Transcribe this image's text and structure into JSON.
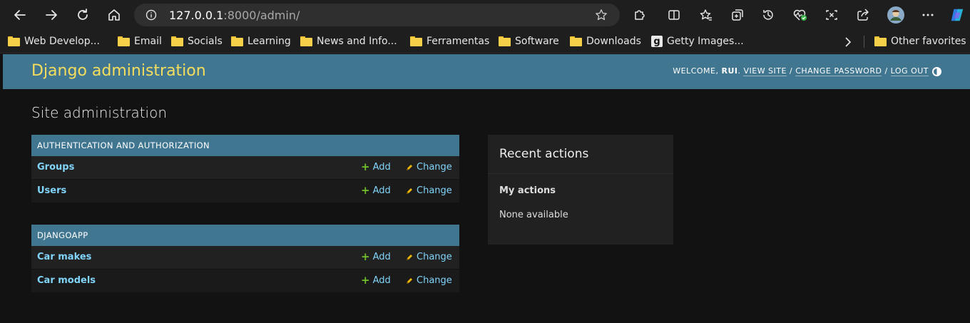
{
  "browser": {
    "url_host": "127.0.0.1",
    "url_rest": ":8000/admin/",
    "bookmarks": [
      {
        "label": "Web Develop...",
        "icon": "folder-icon"
      },
      {
        "label": "Email",
        "icon": "folder-icon"
      },
      {
        "label": "Socials",
        "icon": "folder-icon"
      },
      {
        "label": "Learning",
        "icon": "folder-icon"
      },
      {
        "label": "News and Info...",
        "icon": "folder-icon"
      },
      {
        "label": "Ferramentas",
        "icon": "folder-icon"
      },
      {
        "label": "Software",
        "icon": "folder-icon"
      },
      {
        "label": "Downloads",
        "icon": "folder-icon"
      },
      {
        "label": "Getty Images...",
        "icon": "getty-g-icon",
        "glyph": "g"
      }
    ],
    "overflow_icon": "chevron-right-icon",
    "other_favorites": "Other favorites"
  },
  "header": {
    "branding": "Django administration",
    "welcome": "Welcome,",
    "username": "rui",
    "view_site": "View site",
    "change_password": "Change password",
    "log_out": "Log out",
    "separator": "/"
  },
  "page_title": "Site administration",
  "modules": [
    {
      "caption": "Authentication and Authorization",
      "models": [
        {
          "name": "Groups",
          "add": "Add",
          "change": "Change"
        },
        {
          "name": "Users",
          "add": "Add",
          "change": "Change"
        }
      ]
    },
    {
      "caption": "DJANGOAPP",
      "models": [
        {
          "name": "Car makes",
          "add": "Add",
          "change": "Change"
        },
        {
          "name": "Car models",
          "add": "Add",
          "change": "Change"
        }
      ]
    }
  ],
  "recent_actions": {
    "title": "Recent actions",
    "subtitle": "My actions",
    "empty": "None available"
  },
  "colors": {
    "header_bg": "#417690",
    "branding": "#f5dd5d",
    "link": "#81d4fa",
    "add_icon": "#70bf2b",
    "change_icon": "#efb80b"
  }
}
